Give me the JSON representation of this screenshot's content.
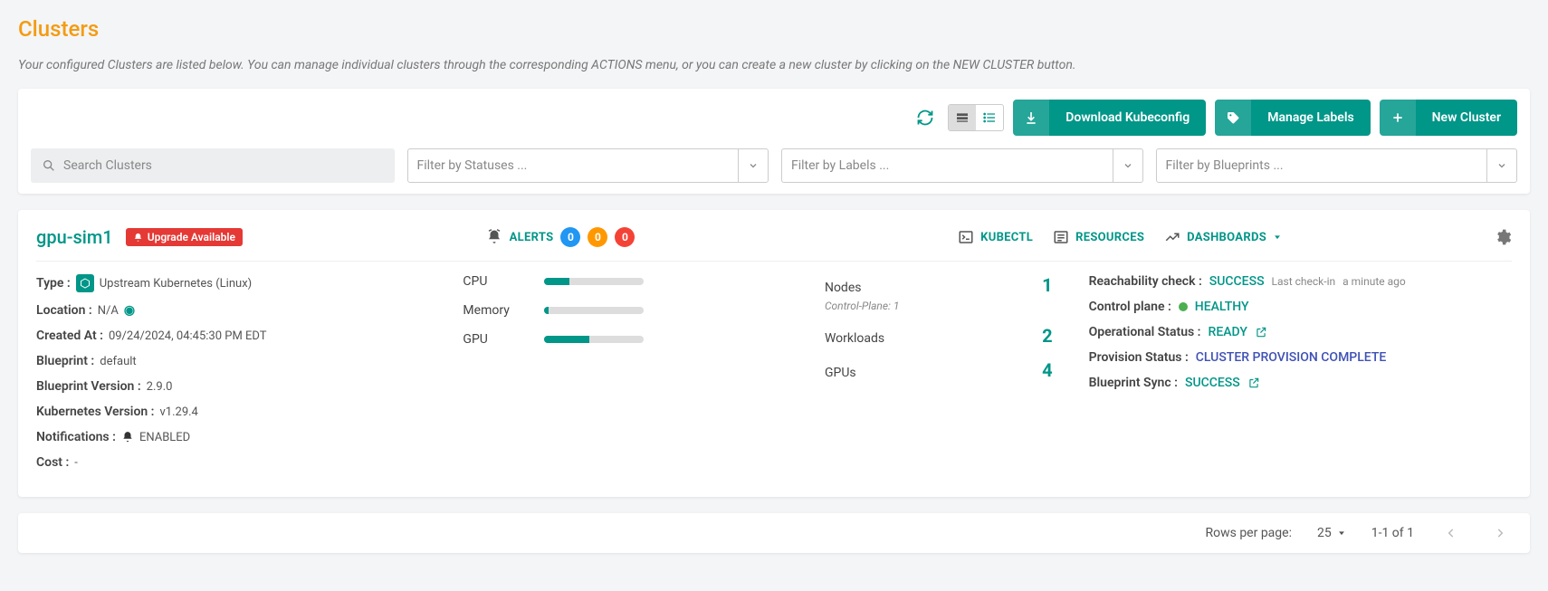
{
  "page": {
    "title": "Clusters",
    "description": "Your configured Clusters are listed below. You can manage individual clusters through the corresponding ACTIONS menu, or you can create a new cluster by clicking on the NEW CLUSTER button."
  },
  "toolbar": {
    "download_label": "Download Kubeconfig",
    "labels_label": "Manage Labels",
    "new_label": "New Cluster",
    "search_placeholder": "Search Clusters",
    "filter_status_placeholder": "Filter by Statuses ...",
    "filter_labels_placeholder": "Filter by Labels ...",
    "filter_blueprints_placeholder": "Filter by Blueprints ..."
  },
  "cluster": {
    "name": "gpu-sim1",
    "upgrade_badge": "Upgrade Available",
    "alerts_label": "ALERTS",
    "alerts": {
      "info": "0",
      "warn": "0",
      "error": "0"
    },
    "links": {
      "kubectl": "KUBECTL",
      "resources": "RESOURCES",
      "dashboards": "DASHBOARDS"
    },
    "meta": {
      "type_label": "Type :",
      "type_value": "Upstream Kubernetes (Linux)",
      "location_label": "Location :",
      "location_value": "N/A",
      "created_label": "Created At :",
      "created_value": "09/24/2024, 04:45:30 PM EDT",
      "blueprint_label": "Blueprint :",
      "blueprint_value": "default",
      "bpver_label": "Blueprint Version :",
      "bpver_value": "2.9.0",
      "kver_label": "Kubernetes Version :",
      "kver_value": "v1.29.4",
      "notif_label": "Notifications :",
      "notif_value": "ENABLED",
      "cost_label": "Cost :",
      "cost_value": "-"
    },
    "metrics": {
      "cpu_label": "CPU",
      "cpu_pct": 25,
      "mem_label": "Memory",
      "mem_pct": 4,
      "gpu_label": "GPU",
      "gpu_pct": 45
    },
    "counts": {
      "nodes_label": "Nodes",
      "nodes_value": "1",
      "nodes_sub": "Control-Plane: 1",
      "workloads_label": "Workloads",
      "workloads_value": "2",
      "gpus_label": "GPUs",
      "gpus_value": "4"
    },
    "status": {
      "reach_label": "Reachability check :",
      "reach_value": "SUCCESS",
      "checkin_label": "Last check-in",
      "checkin_value": "a minute ago",
      "cp_label": "Control plane :",
      "cp_value": "HEALTHY",
      "op_label": "Operational Status :",
      "op_value": "READY",
      "prov_label": "Provision Status :",
      "prov_value": "CLUSTER PROVISION COMPLETE",
      "sync_label": "Blueprint Sync :",
      "sync_value": "SUCCESS"
    }
  },
  "footer": {
    "rows_label": "Rows per page:",
    "rows_value": "25",
    "range": "1-1 of 1"
  }
}
